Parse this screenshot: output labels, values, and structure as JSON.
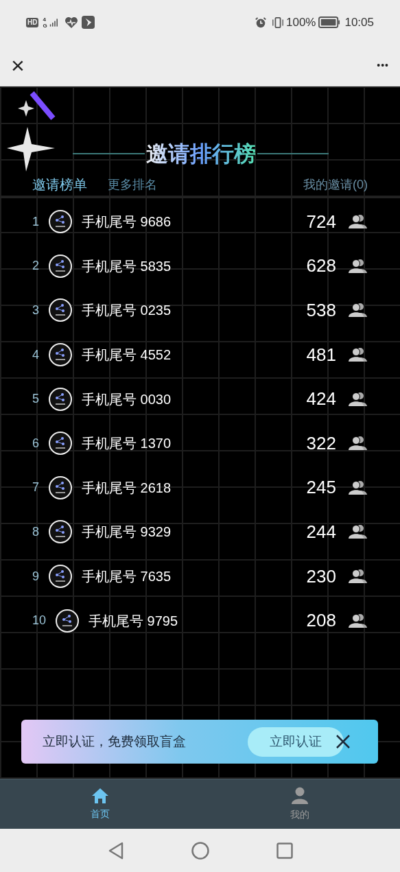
{
  "status_bar": {
    "left_badge": "HD",
    "network": "4G",
    "battery_text": "100%",
    "time": "10:05"
  },
  "header": {
    "close": "×",
    "more": "•••"
  },
  "title": "邀请排行榜",
  "tabs": [
    {
      "label": "邀请榜单",
      "selected": true
    },
    {
      "label": "更多排名",
      "selected": false
    }
  ],
  "my_invites": "我的邀请(0)",
  "ranking": [
    {
      "rank": "1",
      "name": "手机尾号 9686",
      "count": "724"
    },
    {
      "rank": "2",
      "name": "手机尾号 5835",
      "count": "628"
    },
    {
      "rank": "3",
      "name": "手机尾号 0235",
      "count": "538"
    },
    {
      "rank": "4",
      "name": "手机尾号 4552",
      "count": "481"
    },
    {
      "rank": "5",
      "name": "手机尾号 0030",
      "count": "424"
    },
    {
      "rank": "6",
      "name": "手机尾号 1370",
      "count": "322"
    },
    {
      "rank": "7",
      "name": "手机尾号 2618",
      "count": "245"
    },
    {
      "rank": "8",
      "name": "手机尾号 9329",
      "count": "244"
    },
    {
      "rank": "9",
      "name": "手机尾号 7635",
      "count": "230"
    },
    {
      "rank": "10",
      "name": "手机尾号 9795",
      "count": "208"
    }
  ],
  "banner": {
    "text": "立即认证，免费领取盲盒",
    "button": "立即认证"
  },
  "bottom_tabs": [
    {
      "label": "首页",
      "kind": "home",
      "selected": true
    },
    {
      "label": "我的",
      "kind": "profile",
      "selected": false
    }
  ]
}
